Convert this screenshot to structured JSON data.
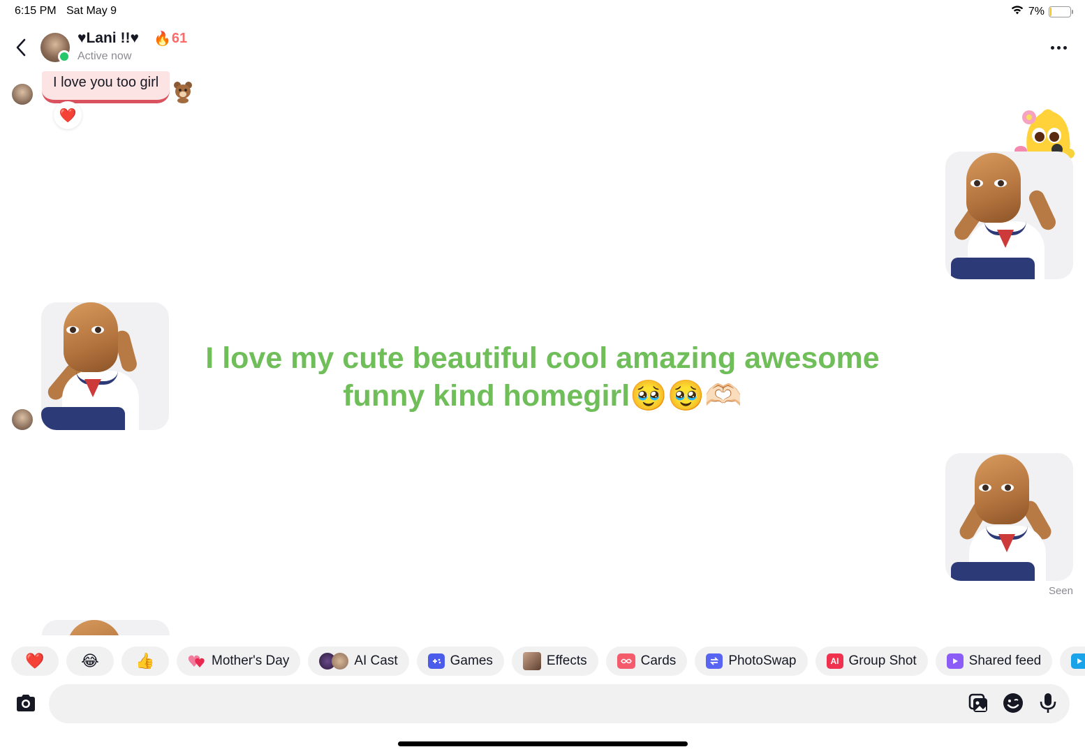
{
  "status_bar": {
    "time": "6:15 PM",
    "date": "Sat May 9",
    "battery_percent": "7%",
    "battery_level": 0.07
  },
  "header": {
    "contact_name": "♥Lani !!♥",
    "streak_emoji": "🔥",
    "streak_count": "61",
    "active_status": "Active now"
  },
  "messages": {
    "received_text": "I love you too girl",
    "reaction_emoji": "❤️",
    "center_message": "I love my cute beautiful cool amazing awesome funny kind homegirl🥹🥹🫶🏻",
    "seen_label": "Seen"
  },
  "quick_bar": {
    "heart": "❤️",
    "laugh": "😂",
    "thumbs": "👍",
    "mothers_day": "Mother's Day",
    "ai_cast": "AI Cast",
    "games": "Games",
    "effects": "Effects",
    "cards": "Cards",
    "photoswap": "PhotoSwap",
    "group_shot": "Group Shot",
    "group_shot_icon_text": "AI",
    "shared_feed": "Shared feed"
  },
  "colors": {
    "accent_green": "#6fbe5a",
    "online_green": "#25c768",
    "streak_red": "#fe6a6a",
    "bubble_pink": "#fde4e4"
  },
  "icons": {
    "back": "chevron-left-icon",
    "more": "more-horizontal-icon",
    "camera": "camera-icon",
    "gallery": "gallery-icon",
    "emoji": "emoji-icon",
    "mic": "microphone-icon"
  }
}
